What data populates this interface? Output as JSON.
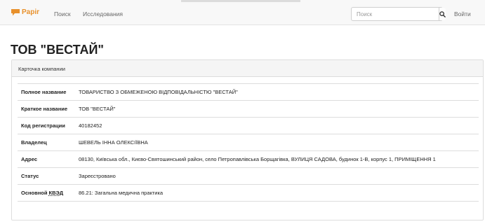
{
  "header": {
    "brand": "Papir",
    "brand_color": "#e8912c",
    "brand_icon": "speech-bubble-icon",
    "nav": [
      {
        "label": "Поиск"
      },
      {
        "label": "Исследования"
      }
    ],
    "search": {
      "placeholder": "Поиск",
      "value": "",
      "button_icon": "search-icon"
    },
    "login_label": "Войти"
  },
  "page": {
    "title": "ТОВ \"ВЕСТАЙ\""
  },
  "card": {
    "heading": "Карточка компании",
    "rows": [
      {
        "label": "Полное название",
        "value": "ТОВАРИСТВО З ОБМЕЖЕНОЮ ВІДПОВІДАЛЬНІСТЮ \"ВЕСТАЙ\""
      },
      {
        "label": "Краткое название",
        "value": "ТОВ \"ВЕСТАЙ\""
      },
      {
        "label": "Код регистрации",
        "value": "40182452"
      },
      {
        "label": "Владелец",
        "value": "ШЕВЕЛЬ ІННА ОЛЕКСІЇВНА"
      },
      {
        "label": "Адрес",
        "value": "08130, Київська обл., Києво-Святошинський район, село Петропавлівська Борщагівка, ВУЛИЦЯ САДОВА, будинок 1-В, корпус 1, ПРИМІЩЕННЯ 1"
      },
      {
        "label": "Статус",
        "value": "Зареєстровано"
      },
      {
        "label_prefix": "Основной ",
        "label_abbr": "КВЭД",
        "value": "86.21: Загальна медична практика"
      }
    ]
  }
}
